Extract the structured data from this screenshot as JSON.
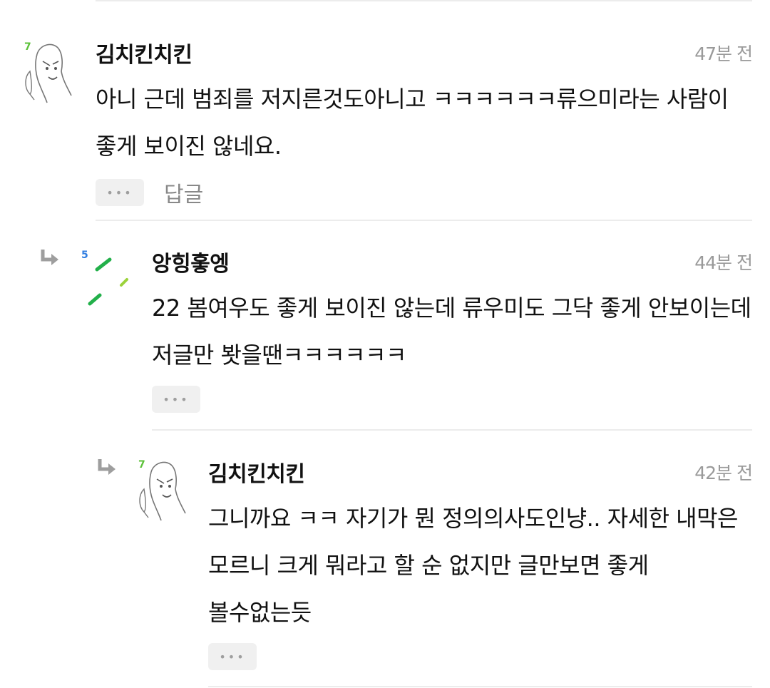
{
  "comments": [
    {
      "author": "김치킨치킨",
      "time": "47분 전",
      "text": "아니 근데 범죄를 저지른것도아니고 ㅋㅋㅋㅋㅋㅋ류으미라는 사람이 좋게 보이진 않네요.",
      "level": "7",
      "more_label": "•••",
      "reply_label": "답글"
    },
    {
      "author": "앙힝홓엥",
      "time": "44분 전",
      "text": "22 봄여우도 좋게 보이진 않는데 류우미도 그닥 좋게 안보이는데 저글만 봣을땐ㅋㅋㅋㅋㅋㅋ",
      "level": "5",
      "more_label": "•••"
    },
    {
      "author": "김치킨치킨",
      "time": "42분 전",
      "text": "그니까요 ㅋㅋ 자기가 뭔 정의의사도인냥.. 자세한 내막은 모르니 크게 뭐라고 할 순 없지만 글만보면 좋게 볼수없는듯",
      "level": "7",
      "more_label": "•••"
    }
  ],
  "colors": {
    "level7": "#5cc13a",
    "level5": "#2f7de1",
    "reply_arrow": "#9e9e9e"
  }
}
